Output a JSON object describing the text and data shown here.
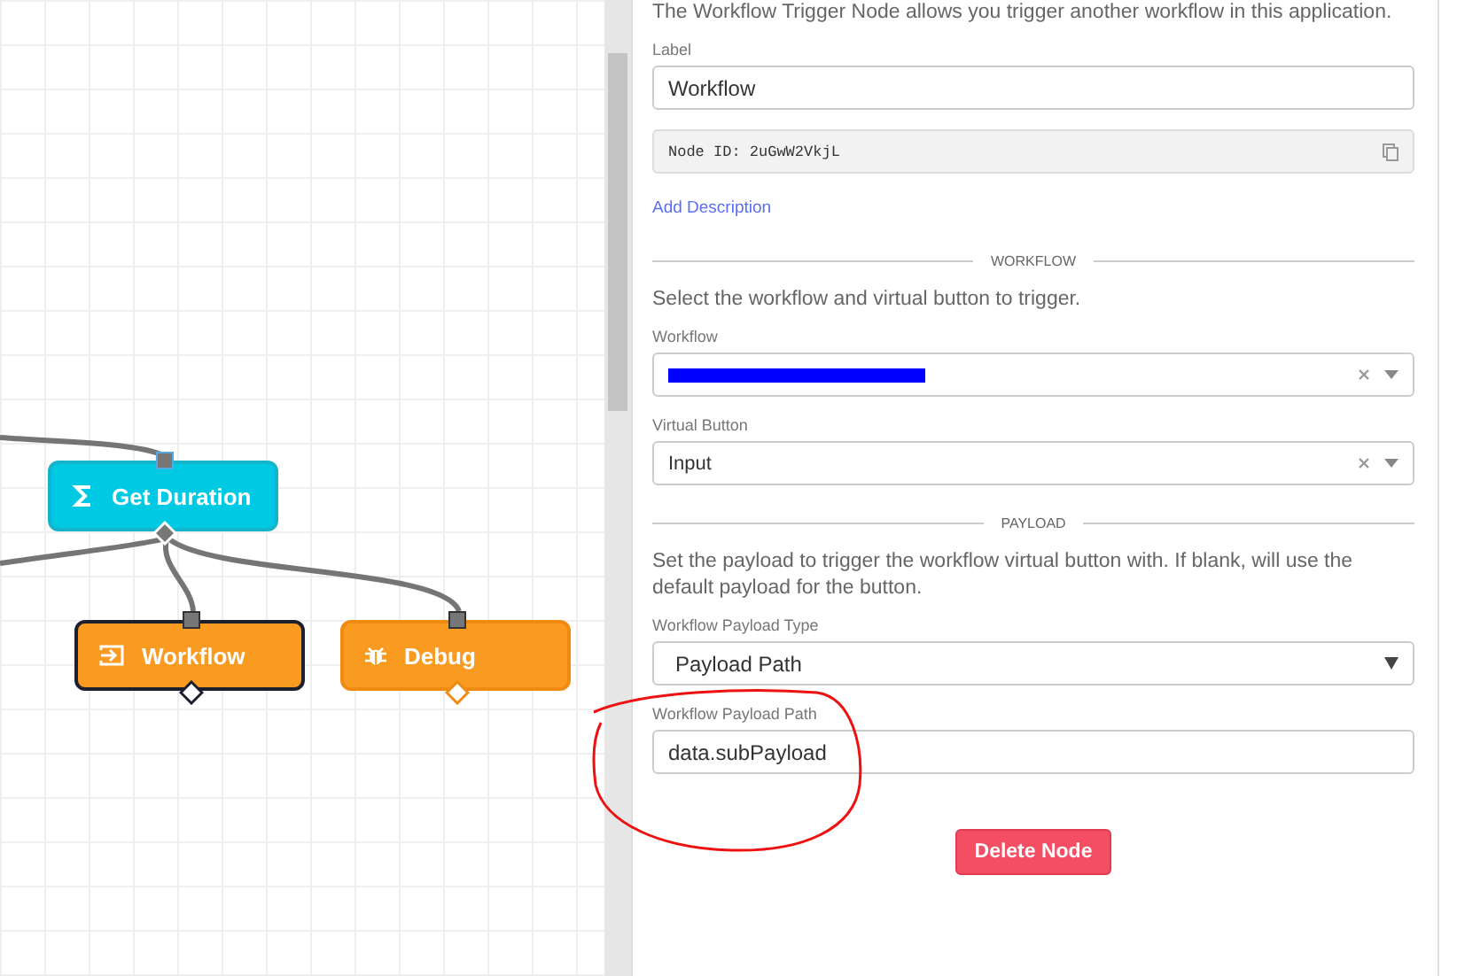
{
  "canvas": {
    "nodes": [
      {
        "kind": "sum",
        "label": "Get Duration",
        "selected": false
      },
      {
        "kind": "workflow",
        "label": "Workflow",
        "selected": true
      },
      {
        "kind": "debug",
        "label": "Debug",
        "selected": false
      }
    ]
  },
  "panel": {
    "description": "The Workflow Trigger Node allows you trigger another workflow in this application.",
    "sections": [
      {
        "fields": [
          {
            "kind": "text",
            "label": "Label",
            "value": "Workflow"
          },
          {
            "kind": "node-id",
            "value": "Node ID: 2uGwW2VkjL"
          },
          {
            "kind": "link",
            "value": "Add Description"
          }
        ]
      },
      {
        "title": "WORKFLOW",
        "description": "Select the workflow and virtual button to trigger.",
        "fields": [
          {
            "kind": "combo",
            "label": "Workflow",
            "redacted": true
          },
          {
            "kind": "combo",
            "label": "Virtual Button",
            "value": "Input"
          }
        ]
      },
      {
        "title": "PAYLOAD",
        "description": "Set the payload to trigger the workflow virtual button with. If blank, will use the default payload for the button.",
        "fields": [
          {
            "kind": "dropdown",
            "label": "Workflow Payload Type",
            "value": "Payload Path"
          },
          {
            "kind": "text",
            "label": "Workflow Payload Path",
            "value": "data.subPayload"
          }
        ]
      }
    ],
    "delete_button": "Delete Node"
  }
}
